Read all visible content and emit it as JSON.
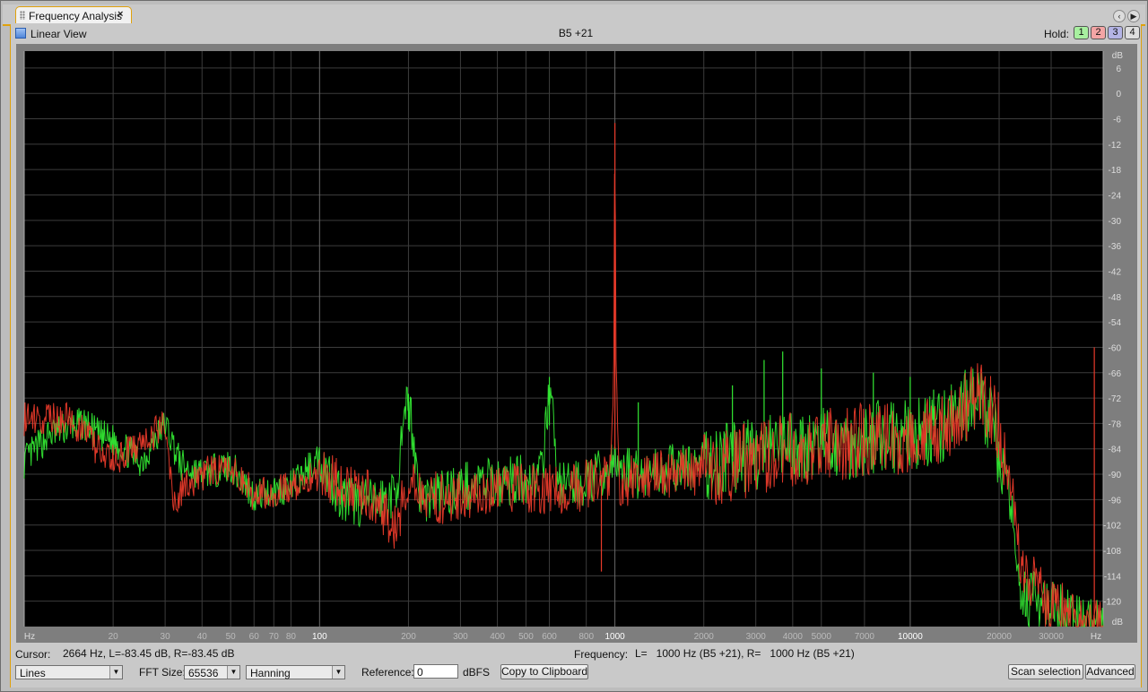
{
  "window": {
    "tab_title": "Frequency Analysis",
    "tab_close": "×",
    "menu_arrow": "▶"
  },
  "toolbar": {
    "linear_view_label": "Linear View",
    "chart_title": "B5 +21",
    "hold_label": "Hold:",
    "hold_buttons": [
      {
        "label": "1",
        "color": "#a8f0a0"
      },
      {
        "label": "2",
        "color": "#f3a5a5"
      },
      {
        "label": "3",
        "color": "#b4b4e6"
      },
      {
        "label": "4",
        "color": "#dedede"
      }
    ]
  },
  "status": {
    "cursor_label": "Cursor:",
    "cursor_value": "2664 Hz, L=-83.45 dB, R=-83.45 dB",
    "frequency_label": "Frequency:",
    "frequency_value": "L=   1000 Hz (B5 +21), R=   1000 Hz (B5 +21)"
  },
  "controls": {
    "display_mode": "Lines",
    "fft_label": "FFT Size:",
    "fft_size": "65536",
    "window_fn": "Hanning",
    "reference_label": "Reference:",
    "reference_value": "0",
    "reference_unit": "dBFS",
    "copy_button": "Copy to Clipboard",
    "scan_button": "Scan selection",
    "advanced_button": "Advanced"
  },
  "chart_data": {
    "type": "line",
    "title": "B5 +21",
    "x_scale": "log",
    "xlim": [
      10,
      45000
    ],
    "ylim": [
      -126,
      10
    ],
    "x_unit_label": "Hz",
    "y_unit_label": "dB",
    "x_ticks": [
      {
        "v": 20,
        "label": "20",
        "major": false
      },
      {
        "v": 30,
        "label": "30",
        "major": false
      },
      {
        "v": 40,
        "label": "40",
        "major": false
      },
      {
        "v": 50,
        "label": "50",
        "major": false
      },
      {
        "v": 60,
        "label": "60",
        "major": false
      },
      {
        "v": 70,
        "label": "70",
        "major": false
      },
      {
        "v": 80,
        "label": "80",
        "major": false
      },
      {
        "v": 100,
        "label": "100",
        "major": true
      },
      {
        "v": 200,
        "label": "200",
        "major": false
      },
      {
        "v": 300,
        "label": "300",
        "major": false
      },
      {
        "v": 400,
        "label": "400",
        "major": false
      },
      {
        "v": 500,
        "label": "500",
        "major": false
      },
      {
        "v": 600,
        "label": "600",
        "major": false
      },
      {
        "v": 800,
        "label": "800",
        "major": false
      },
      {
        "v": 1000,
        "label": "1000",
        "major": true
      },
      {
        "v": 2000,
        "label": "2000",
        "major": false
      },
      {
        "v": 3000,
        "label": "3000",
        "major": false
      },
      {
        "v": 4000,
        "label": "4000",
        "major": false
      },
      {
        "v": 5000,
        "label": "5000",
        "major": false
      },
      {
        "v": 7000,
        "label": "7000",
        "major": false
      },
      {
        "v": 10000,
        "label": "10000",
        "major": true
      },
      {
        "v": 20000,
        "label": "20000",
        "major": false
      },
      {
        "v": 30000,
        "label": "30000",
        "major": false
      }
    ],
    "y_ticks": [
      6,
      0,
      -6,
      -12,
      -18,
      -24,
      -30,
      -36,
      -42,
      -48,
      -54,
      -60,
      -66,
      -72,
      -78,
      -84,
      -90,
      -96,
      -102,
      -108,
      -114,
      -120
    ],
    "grid": true,
    "series": [
      {
        "channel": "left",
        "color": "#33e833",
        "points": [
          [
            10,
            -87
          ],
          [
            12,
            -81
          ],
          [
            14,
            -79
          ],
          [
            16,
            -78
          ],
          [
            18,
            -81
          ],
          [
            20,
            -82
          ],
          [
            25,
            -87
          ],
          [
            30,
            -78
          ],
          [
            34,
            -88
          ],
          [
            40,
            -90
          ],
          [
            50,
            -88
          ],
          [
            60,
            -95
          ],
          [
            80,
            -93
          ],
          [
            100,
            -86
          ],
          [
            120,
            -96
          ],
          [
            150,
            -97
          ],
          [
            180,
            -95
          ],
          [
            200,
            -72
          ],
          [
            220,
            -96
          ],
          [
            300,
            -93
          ],
          [
            400,
            -92
          ],
          [
            500,
            -91
          ],
          [
            570,
            -90
          ],
          [
            600,
            -67
          ],
          [
            640,
            -92
          ],
          [
            700,
            -93
          ],
          [
            800,
            -92
          ],
          [
            1000,
            -88
          ],
          [
            1200,
            -90
          ],
          [
            1500,
            -89
          ],
          [
            2000,
            -88
          ],
          [
            2500,
            -86
          ],
          [
            3000,
            -85
          ],
          [
            4000,
            -84
          ],
          [
            5000,
            -83
          ],
          [
            6000,
            -83
          ],
          [
            7000,
            -82
          ],
          [
            8000,
            -81
          ],
          [
            10000,
            -81
          ],
          [
            13000,
            -79
          ],
          [
            15000,
            -74
          ],
          [
            17000,
            -72
          ],
          [
            19000,
            -78
          ],
          [
            20000,
            -85
          ],
          [
            22000,
            -100
          ],
          [
            24000,
            -118
          ],
          [
            26000,
            -120
          ],
          [
            30000,
            -122
          ],
          [
            36000,
            -124
          ],
          [
            40000,
            -126
          ]
        ],
        "spikes": [
          [
            200,
            -71
          ],
          [
            600,
            -67
          ],
          [
            1200,
            -73
          ],
          [
            2500,
            -69
          ],
          [
            3200,
            -63
          ],
          [
            3700,
            -61
          ],
          [
            5000,
            -65
          ],
          [
            7500,
            -66
          ],
          [
            10000,
            -67
          ],
          [
            12000,
            -70
          ]
        ]
      },
      {
        "channel": "right",
        "color": "#e83a2a",
        "points": [
          [
            10,
            -77
          ],
          [
            14,
            -77
          ],
          [
            16,
            -80
          ],
          [
            18,
            -85
          ],
          [
            20,
            -87
          ],
          [
            25,
            -83
          ],
          [
            30,
            -78
          ],
          [
            32,
            -96
          ],
          [
            36,
            -92
          ],
          [
            40,
            -90
          ],
          [
            50,
            -88
          ],
          [
            60,
            -95
          ],
          [
            80,
            -93
          ],
          [
            100,
            -90
          ],
          [
            150,
            -95
          ],
          [
            180,
            -103
          ],
          [
            200,
            -92
          ],
          [
            260,
            -96
          ],
          [
            300,
            -95
          ],
          [
            400,
            -93
          ],
          [
            500,
            -93
          ],
          [
            700,
            -94
          ],
          [
            900,
            -91
          ],
          [
            960,
            -90
          ],
          [
            990,
            -68
          ],
          [
            1000,
            -7
          ],
          [
            1010,
            -68
          ],
          [
            1040,
            -92
          ],
          [
            1500,
            -90
          ],
          [
            2000,
            -89
          ],
          [
            2500,
            -88
          ],
          [
            3000,
            -86
          ],
          [
            4000,
            -84
          ],
          [
            5000,
            -83
          ],
          [
            7000,
            -82
          ],
          [
            10000,
            -81
          ],
          [
            13000,
            -80
          ],
          [
            15000,
            -75
          ],
          [
            17000,
            -72
          ],
          [
            18500,
            -74
          ],
          [
            20000,
            -80
          ],
          [
            22000,
            -95
          ],
          [
            24000,
            -112
          ],
          [
            27000,
            -118
          ],
          [
            30000,
            -121
          ],
          [
            40000,
            -126
          ]
        ],
        "spikes": [
          [
            180,
            -104
          ],
          [
            900,
            -113
          ],
          [
            1000,
            -7
          ],
          [
            42000,
            -60
          ]
        ]
      }
    ]
  }
}
